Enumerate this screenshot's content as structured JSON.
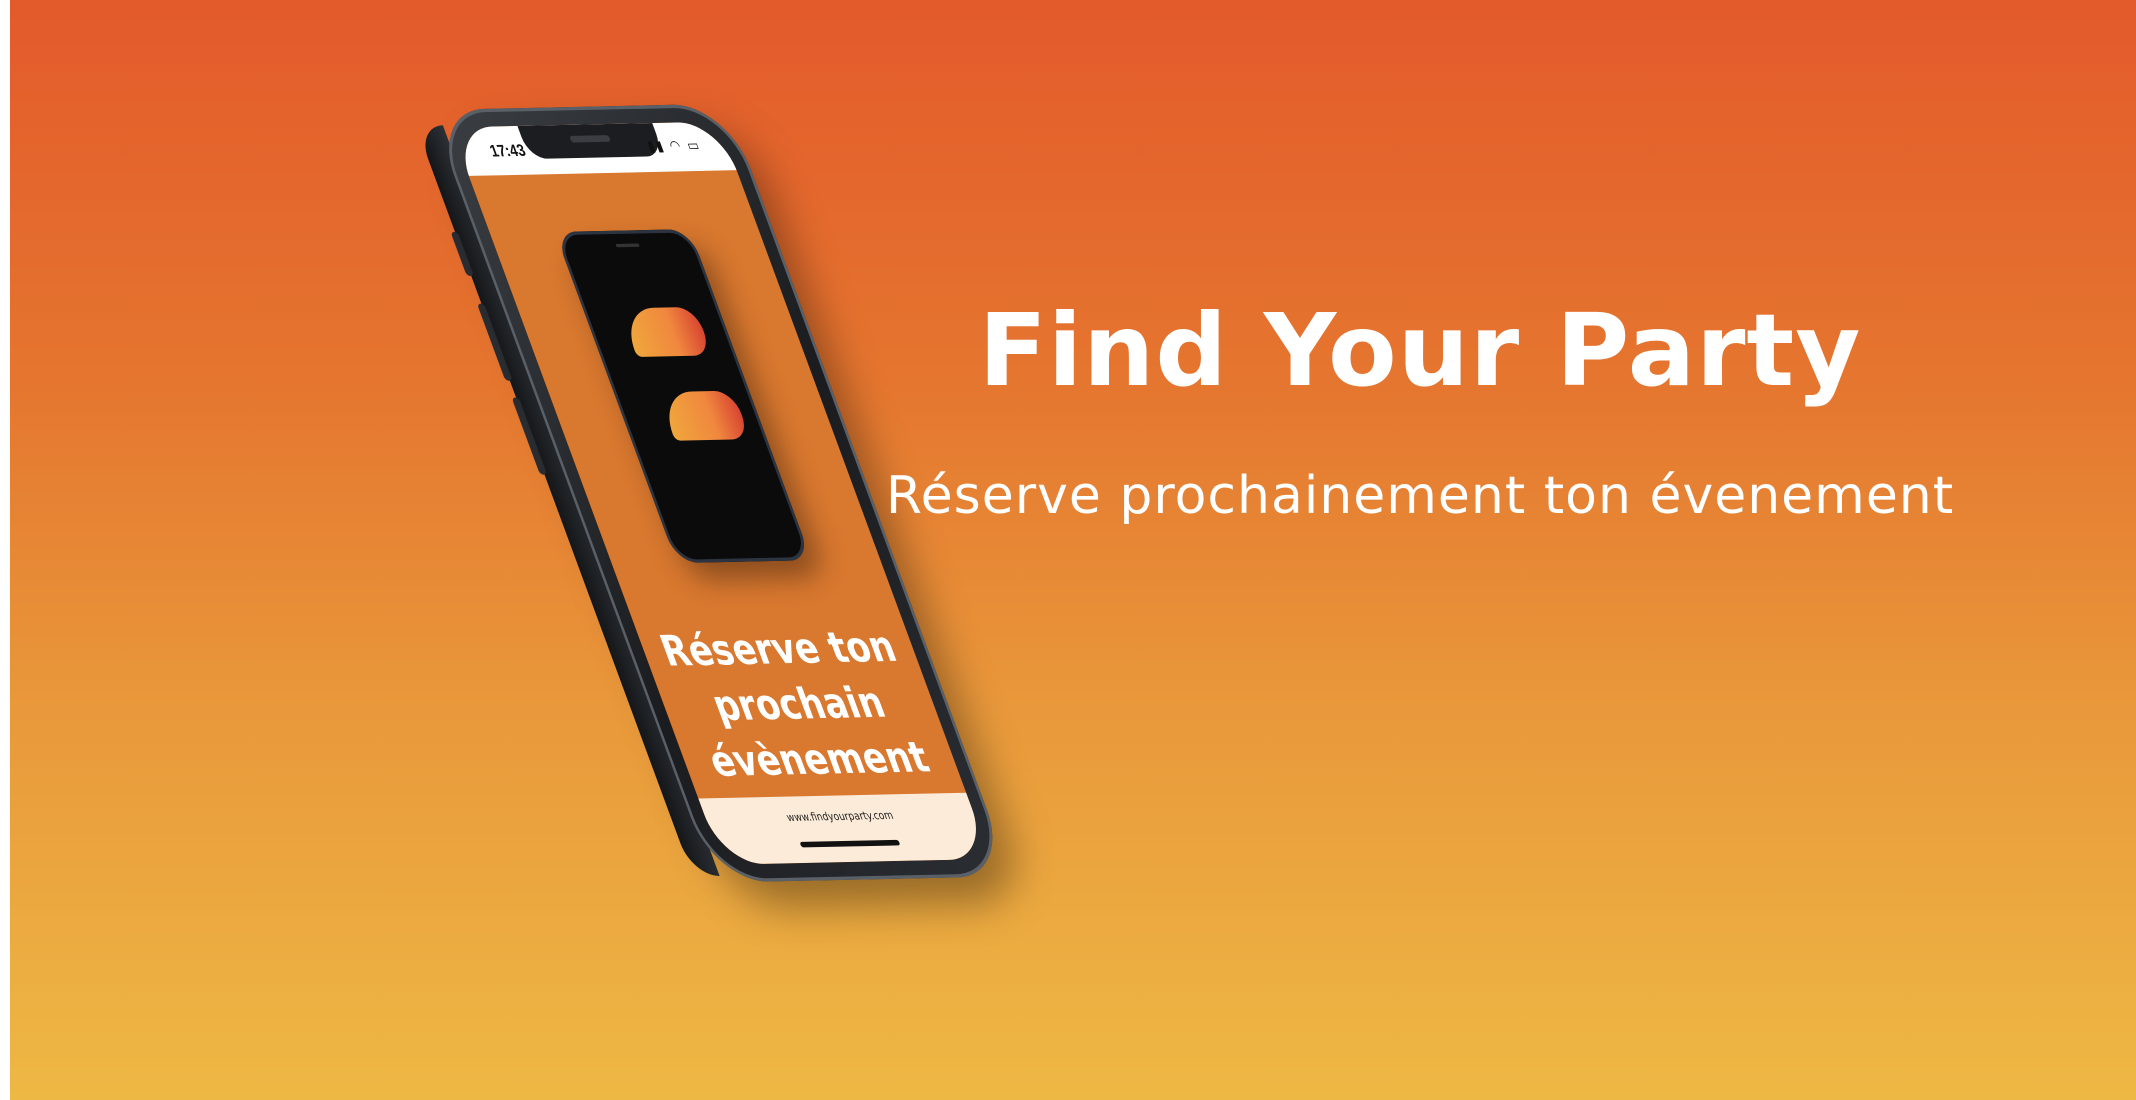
{
  "colors": {
    "gradient_top": "#e35a2b",
    "gradient_bottom": "#eeb844",
    "screen_orange": "#d9782f",
    "text": "#ffffff"
  },
  "phone": {
    "status_time": "17:43",
    "status_icons": "wifi-icon battery-icon",
    "screen_text": "Réserve ton prochain évènement",
    "screen_text_lines": [
      "Réserve ton",
      "prochain",
      "évènement"
    ],
    "url_text": "www.findyourparty.com"
  },
  "hero": {
    "title": "Find Your Party",
    "subtitle": "Réserve prochainement ton évenement"
  }
}
